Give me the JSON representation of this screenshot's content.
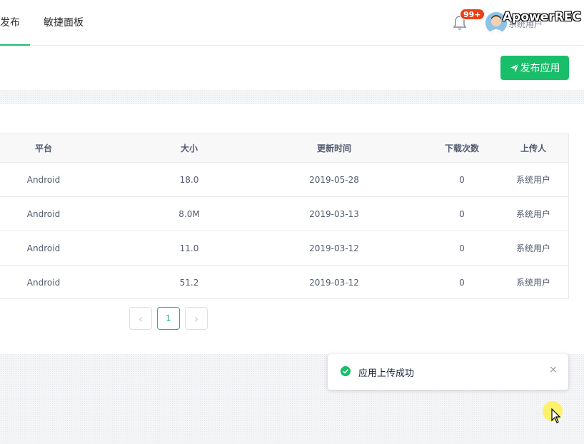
{
  "nav": {
    "tabs": [
      {
        "label": "发布",
        "active": true
      },
      {
        "label": "敏捷面板",
        "active": false
      }
    ],
    "notification_count": "99+",
    "username": "系统用户",
    "watermark": "ApowerREC"
  },
  "toolbar": {
    "publish_label": "发布应用"
  },
  "table": {
    "headers": [
      "平台",
      "大小",
      "更新时间",
      "下载次数",
      "上传人"
    ],
    "rows": [
      [
        "Android",
        "18.0",
        "2019-05-28",
        "0",
        "系统用户"
      ],
      [
        "Android",
        "8.0M",
        "2019-03-13",
        "0",
        "系统用户"
      ],
      [
        "Android",
        "11.0",
        "2019-03-12",
        "0",
        "系统用户"
      ],
      [
        "Android",
        "51.2",
        "2019-03-12",
        "0",
        "系统用户"
      ]
    ]
  },
  "pagination": {
    "prev": "‹",
    "current": "1",
    "next": "›"
  },
  "toast": {
    "message": "应用上传成功",
    "close": "×"
  },
  "colors": {
    "primary": "#19be6b",
    "badge": "#ed4014"
  }
}
